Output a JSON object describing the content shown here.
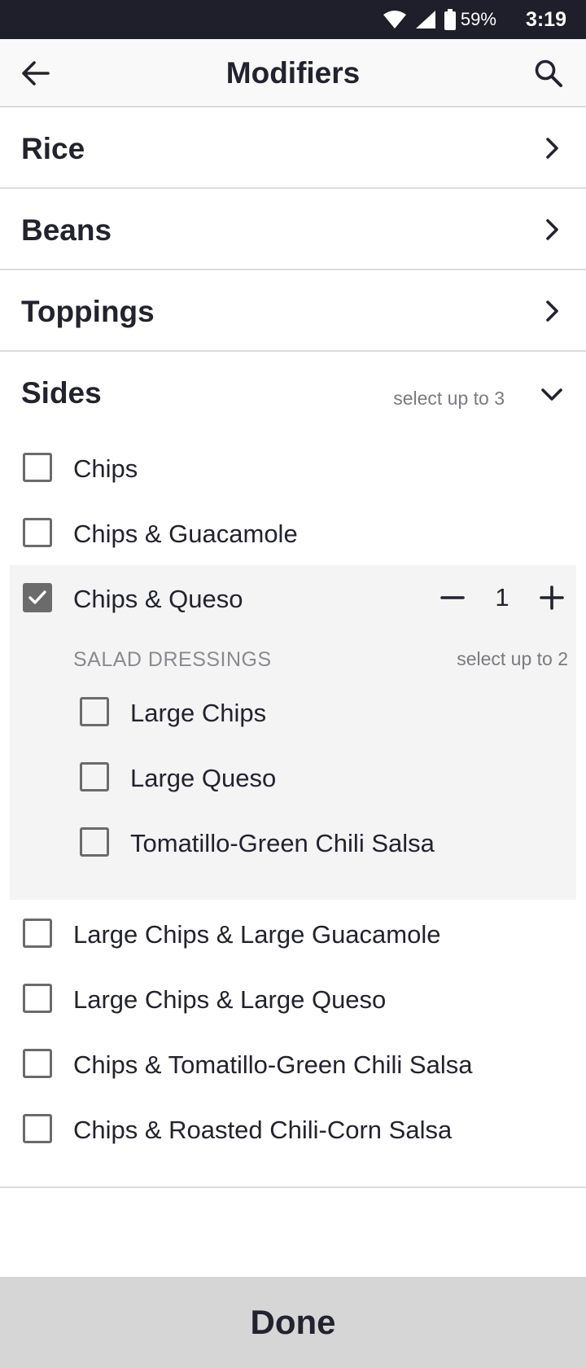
{
  "status_bar": {
    "battery_percent": "59%",
    "time": "3:19"
  },
  "app_bar": {
    "title": "Modifiers",
    "back_icon": "arrow-left-icon",
    "search_icon": "search-icon"
  },
  "sections": [
    {
      "name": "Rice",
      "icon": "chevron-right-icon"
    },
    {
      "name": "Beans",
      "icon": "chevron-right-icon"
    },
    {
      "name": "Toppings",
      "icon": "chevron-right-icon"
    }
  ],
  "sides": {
    "name": "Sides",
    "hint": "select up to 3",
    "icon": "chevron-down-icon",
    "options": [
      {
        "label": "Chips",
        "checked": false
      },
      {
        "label": "Chips & Guacamole",
        "checked": false
      },
      {
        "label": "Chips & Queso",
        "checked": true,
        "quantity": "1"
      },
      {
        "label": "Large Chips & Large Guacamole",
        "checked": false
      },
      {
        "label": "Large Chips & Large Queso",
        "checked": false
      },
      {
        "label": "Chips & Tomatillo-Green Chili Salsa",
        "checked": false
      },
      {
        "label": "Chips & Roasted Chili-Corn Salsa",
        "checked": false
      }
    ],
    "sub_group": {
      "title": "SALAD DRESSINGS",
      "hint": "select up to 2",
      "options": [
        {
          "label": "Large Chips",
          "checked": false
        },
        {
          "label": "Large Queso",
          "checked": false
        },
        {
          "label": "Tomatillo-Green Chili Salsa",
          "checked": false
        }
      ]
    }
  },
  "footer": {
    "done_label": "Done"
  },
  "colors": {
    "status_bar_bg": "#1f1f2b",
    "text": "#23232f",
    "muted": "#7a7a80",
    "checkbox": "#6b6b6b",
    "expanded_bg": "#f4f4f4",
    "done_bg": "#d6d6d6"
  }
}
